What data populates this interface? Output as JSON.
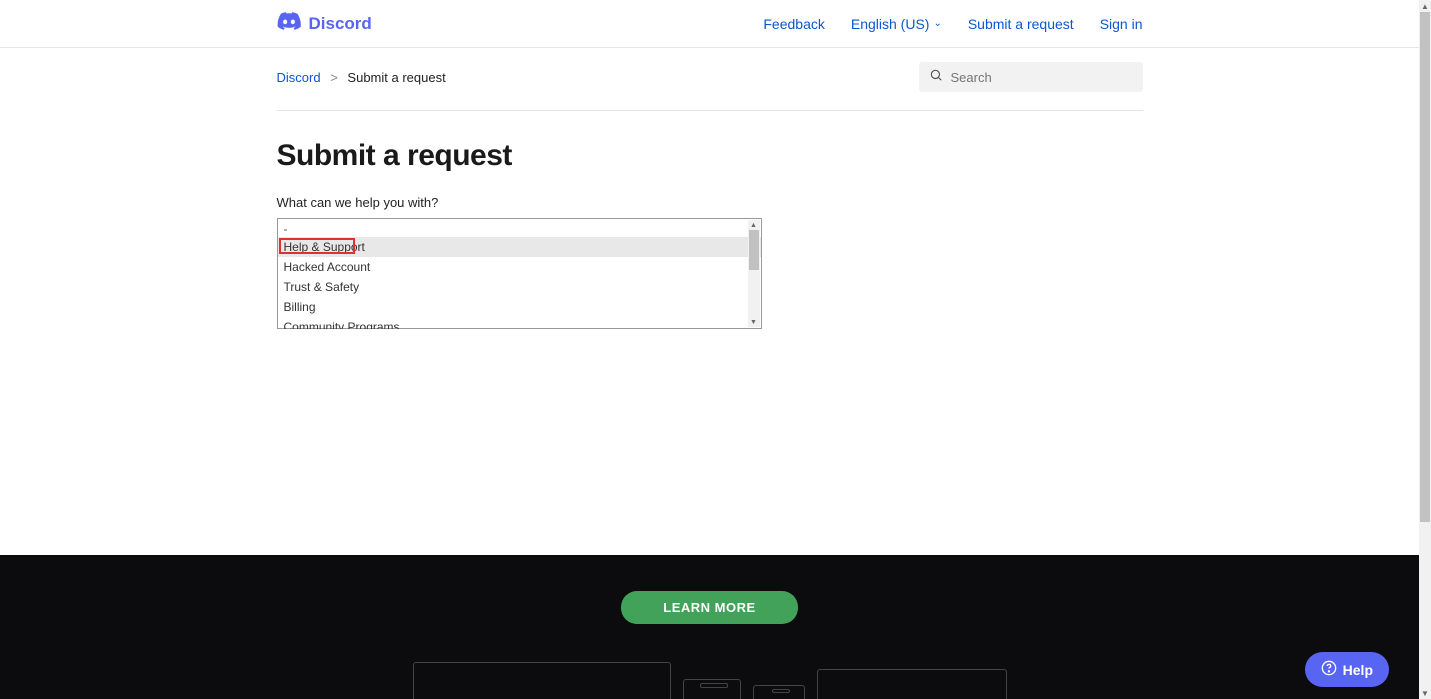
{
  "header": {
    "brand": "Discord",
    "nav": {
      "feedback": "Feedback",
      "language": "English (US)",
      "submit": "Submit a request",
      "signin": "Sign in"
    }
  },
  "breadcrumb": {
    "home": "Discord",
    "current": "Submit a request"
  },
  "search": {
    "placeholder": "Search"
  },
  "page": {
    "title": "Submit a request",
    "question_label": "What can we help you with?"
  },
  "dropdown": {
    "selected": "-",
    "options": [
      "Help & Support",
      "Hacked Account",
      "Trust & Safety",
      "Billing",
      "Community Programs"
    ]
  },
  "footer": {
    "learn_more": "LEARN MORE"
  },
  "help_widget": {
    "label": "Help"
  }
}
